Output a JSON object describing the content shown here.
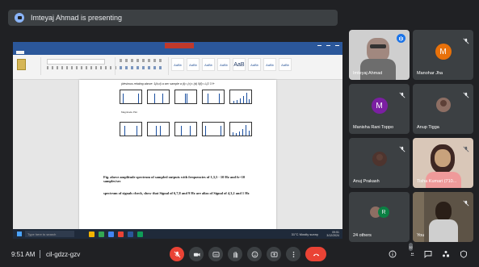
{
  "banner": {
    "text": "Imteyaj Ahmad is presenting"
  },
  "shared_screen": {
    "page_title": "(desirous relating above: 1(b,d) a sec sample a (t)= (c)= (d) 5(f)= L(2 3 f+",
    "sub_label": "Magnitude Plot",
    "caption_1": "Fig. above amplitude spectrum of sampled outputs with  frequencies of 1,3,5 - 10 Hz and fs=10 samples/sec",
    "caption_2": "spectrum of signals check, show that Signal of 6,7,8 and 9 Hz are alias of Signal of 4,3,2 and 1 Hz",
    "taskbar": {
      "search_placeholder": "Type here to search",
      "weather": "31°C Mostly sunny",
      "time": "09:51",
      "date": "3/12/2024"
    }
  },
  "participants": [
    {
      "name": "Imteyaj Ahmad",
      "type": "video",
      "speaking": true
    },
    {
      "name": "Manohar Jha",
      "type": "letter",
      "letter": "M",
      "color": "#e8710a",
      "muted": true
    },
    {
      "name": "Manisha Rani Toppo",
      "type": "letter",
      "letter": "M",
      "color": "#7b1fa2",
      "muted": true
    },
    {
      "name": "Anup Tigga",
      "type": "photo",
      "muted": true
    },
    {
      "name": "Anuj Prakash",
      "type": "photo",
      "muted": true
    },
    {
      "name": "Tisha Kumari (710...",
      "type": "video",
      "muted": false
    },
    {
      "name": "24 others",
      "type": "group"
    },
    {
      "name": "You",
      "type": "video",
      "muted": true
    }
  ],
  "bottom_bar": {
    "time": "9:51 AM",
    "meeting_code": "cil-gdzz-gzv",
    "people_count": "32"
  },
  "icons": {
    "mic_off": "mic-off-icon",
    "camera": "camera-icon",
    "captions": "captions-icon",
    "raise_hand": "raise-hand-icon",
    "emoji": "emoji-icon",
    "present": "present-icon",
    "more": "more-options-icon",
    "end_call": "end-call-icon",
    "info": "info-icon",
    "people": "people-icon",
    "chat": "chat-icon",
    "activities": "activities-icon",
    "host_controls": "host-controls-icon"
  }
}
